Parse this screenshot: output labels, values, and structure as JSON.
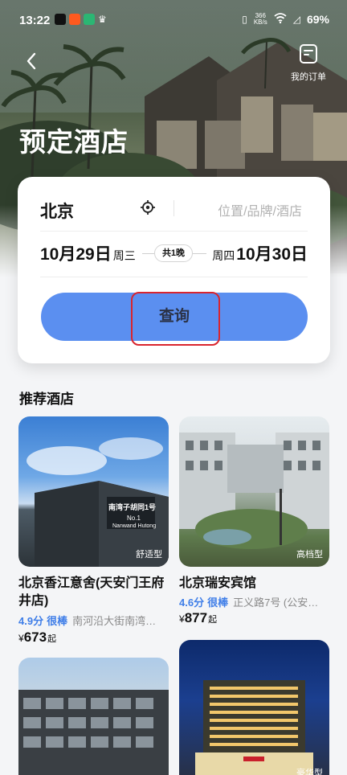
{
  "status": {
    "time": "13:22",
    "net_speed_value": "366",
    "net_speed_unit": "KB/s",
    "battery": "69%"
  },
  "header": {
    "back_icon": "chevron-left-icon",
    "orders_label": "我的订单",
    "title": "预定酒店"
  },
  "search": {
    "city": "北京",
    "keyword_placeholder": "位置/品牌/酒店",
    "checkin_date": "10月29日",
    "checkin_weekday": "周三",
    "nights": "共1晚",
    "checkout_weekday": "周四",
    "checkout_date": "10月30日",
    "query_label": "查询"
  },
  "recommended": {
    "title": "推荐酒店",
    "hotels": [
      {
        "name": "北京香江意舍(天安门王府井店)",
        "tag": "舒适型",
        "score": "4.9分",
        "level": "很棒",
        "address": "南河沿大街南湾…",
        "currency": "¥",
        "price": "673",
        "price_suffix": "起",
        "sign_text": "南湾子胡同1号",
        "sign_sub": "No.1",
        "sign_sub2": "Nanwand Hutong"
      },
      {
        "name": "北京瑞安宾馆",
        "tag": "高档型",
        "score": "4.6分",
        "level": "很棒",
        "address": "正义路7号 (公安…",
        "currency": "¥",
        "price": "877",
        "price_suffix": "起"
      },
      {
        "name": "",
        "tag": ""
      },
      {
        "name": "",
        "tag": "豪华型"
      }
    ]
  },
  "colors": {
    "accent_blue": "#5b8ff0",
    "rating_blue": "#3f7ee8",
    "highlight_red": "#d9252e"
  }
}
